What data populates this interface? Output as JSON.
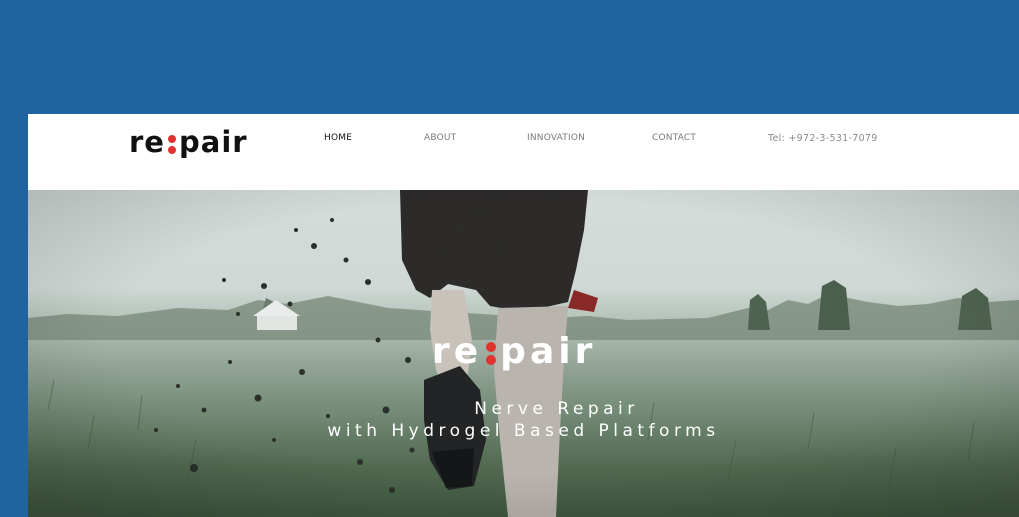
{
  "logo": {
    "part1": "re",
    "part2": "pair"
  },
  "nav": [
    {
      "label": "HOME",
      "active": true
    },
    {
      "label": "ABOUT",
      "active": false
    },
    {
      "label": "INNOVATION",
      "active": false
    },
    {
      "label": "CONTACT",
      "active": false
    }
  ],
  "header": {
    "tel": "Tel: +972-3-531-7079"
  },
  "hero": {
    "logo_part1": "re",
    "logo_part2": "pair",
    "line1": "Nerve Repair",
    "line2": "with Hydrogel Based Platforms"
  },
  "colors": {
    "page_background": "#1f64a0",
    "accent_red": "#e0332f",
    "header_background": "#ffffff"
  }
}
